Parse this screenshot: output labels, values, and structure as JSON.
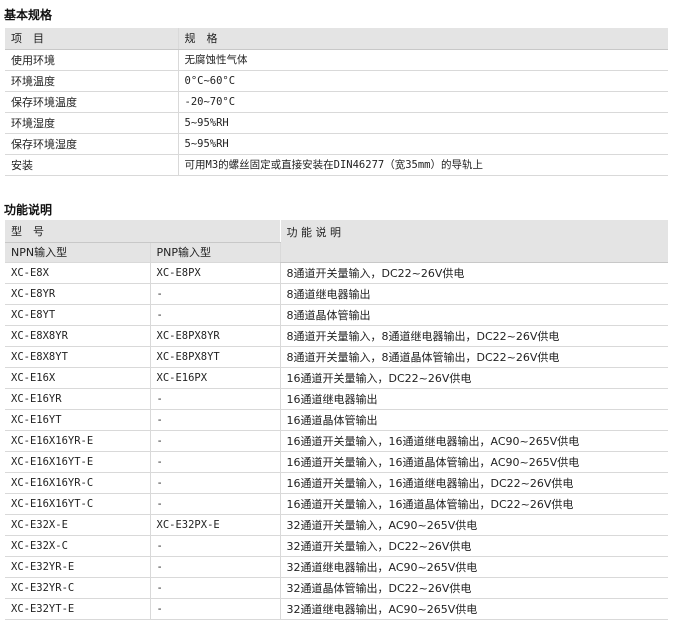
{
  "basic_specs": {
    "title": "基本规格",
    "headers": [
      "项　目",
      "规　格"
    ],
    "rows": [
      [
        "使用环境",
        "无腐蚀性气体"
      ],
      [
        "环境温度",
        "0°C~60°C"
      ],
      [
        "保存环境温度",
        "-20~70°C"
      ],
      [
        "环境湿度",
        "5~95%RH"
      ],
      [
        "保存环境湿度",
        "5~95%RH"
      ],
      [
        "安装",
        "可用M3的螺丝固定或直接安装在DIN46277（宽35mm）的导轨上"
      ]
    ]
  },
  "function_desc": {
    "title": "功能说明",
    "header_model": "型　号",
    "header_function": "功 能 说 明",
    "sub_npn": "NPN输入型",
    "sub_pnp": "PNP输入型",
    "rows": [
      [
        "XC-E8X",
        "XC-E8PX",
        "8通道开关量输入，DC22~26V供电"
      ],
      [
        "XC-E8YR",
        "-",
        "8通道继电器输出"
      ],
      [
        "XC-E8YT",
        "-",
        "8通道晶体管输出"
      ],
      [
        "XC-E8X8YR",
        "XC-E8PX8YR",
        "8通道开关量输入，8通道继电器输出，DC22~26V供电"
      ],
      [
        "XC-E8X8YT",
        "XC-E8PX8YT",
        "8通道开关量输入，8通道晶体管输出，DC22~26V供电"
      ],
      [
        "XC-E16X",
        "XC-E16PX",
        "16通道开关量输入，DC22~26V供电"
      ],
      [
        "XC-E16YR",
        "-",
        "16通道继电器输出"
      ],
      [
        "XC-E16YT",
        "-",
        "16通道晶体管输出"
      ],
      [
        "XC-E16X16YR-E",
        "-",
        "16通道开关量输入，16通道继电器输出，AC90~265V供电"
      ],
      [
        "XC-E16X16YT-E",
        "-",
        "16通道开关量输入，16通道晶体管输出，AC90~265V供电"
      ],
      [
        "XC-E16X16YR-C",
        "-",
        "16通道开关量输入，16通道继电器输出，DC22~26V供电"
      ],
      [
        "XC-E16X16YT-C",
        "-",
        "16通道开关量输入，16通道晶体管输出，DC22~26V供电"
      ],
      [
        "XC-E32X-E",
        "XC-E32PX-E",
        "32通道开关量输入，AC90~265V供电"
      ],
      [
        "XC-E32X-C",
        "-",
        "32通道开关量输入，DC22~26V供电"
      ],
      [
        "XC-E32YR-E",
        "-",
        "32通道继电器输出，AC90~265V供电"
      ],
      [
        "XC-E32YR-C",
        "-",
        "32通道晶体管输出，DC22~26V供电"
      ],
      [
        "XC-E32YT-E",
        "-",
        "32通道继电器输出，AC90~265V供电"
      ]
    ]
  }
}
